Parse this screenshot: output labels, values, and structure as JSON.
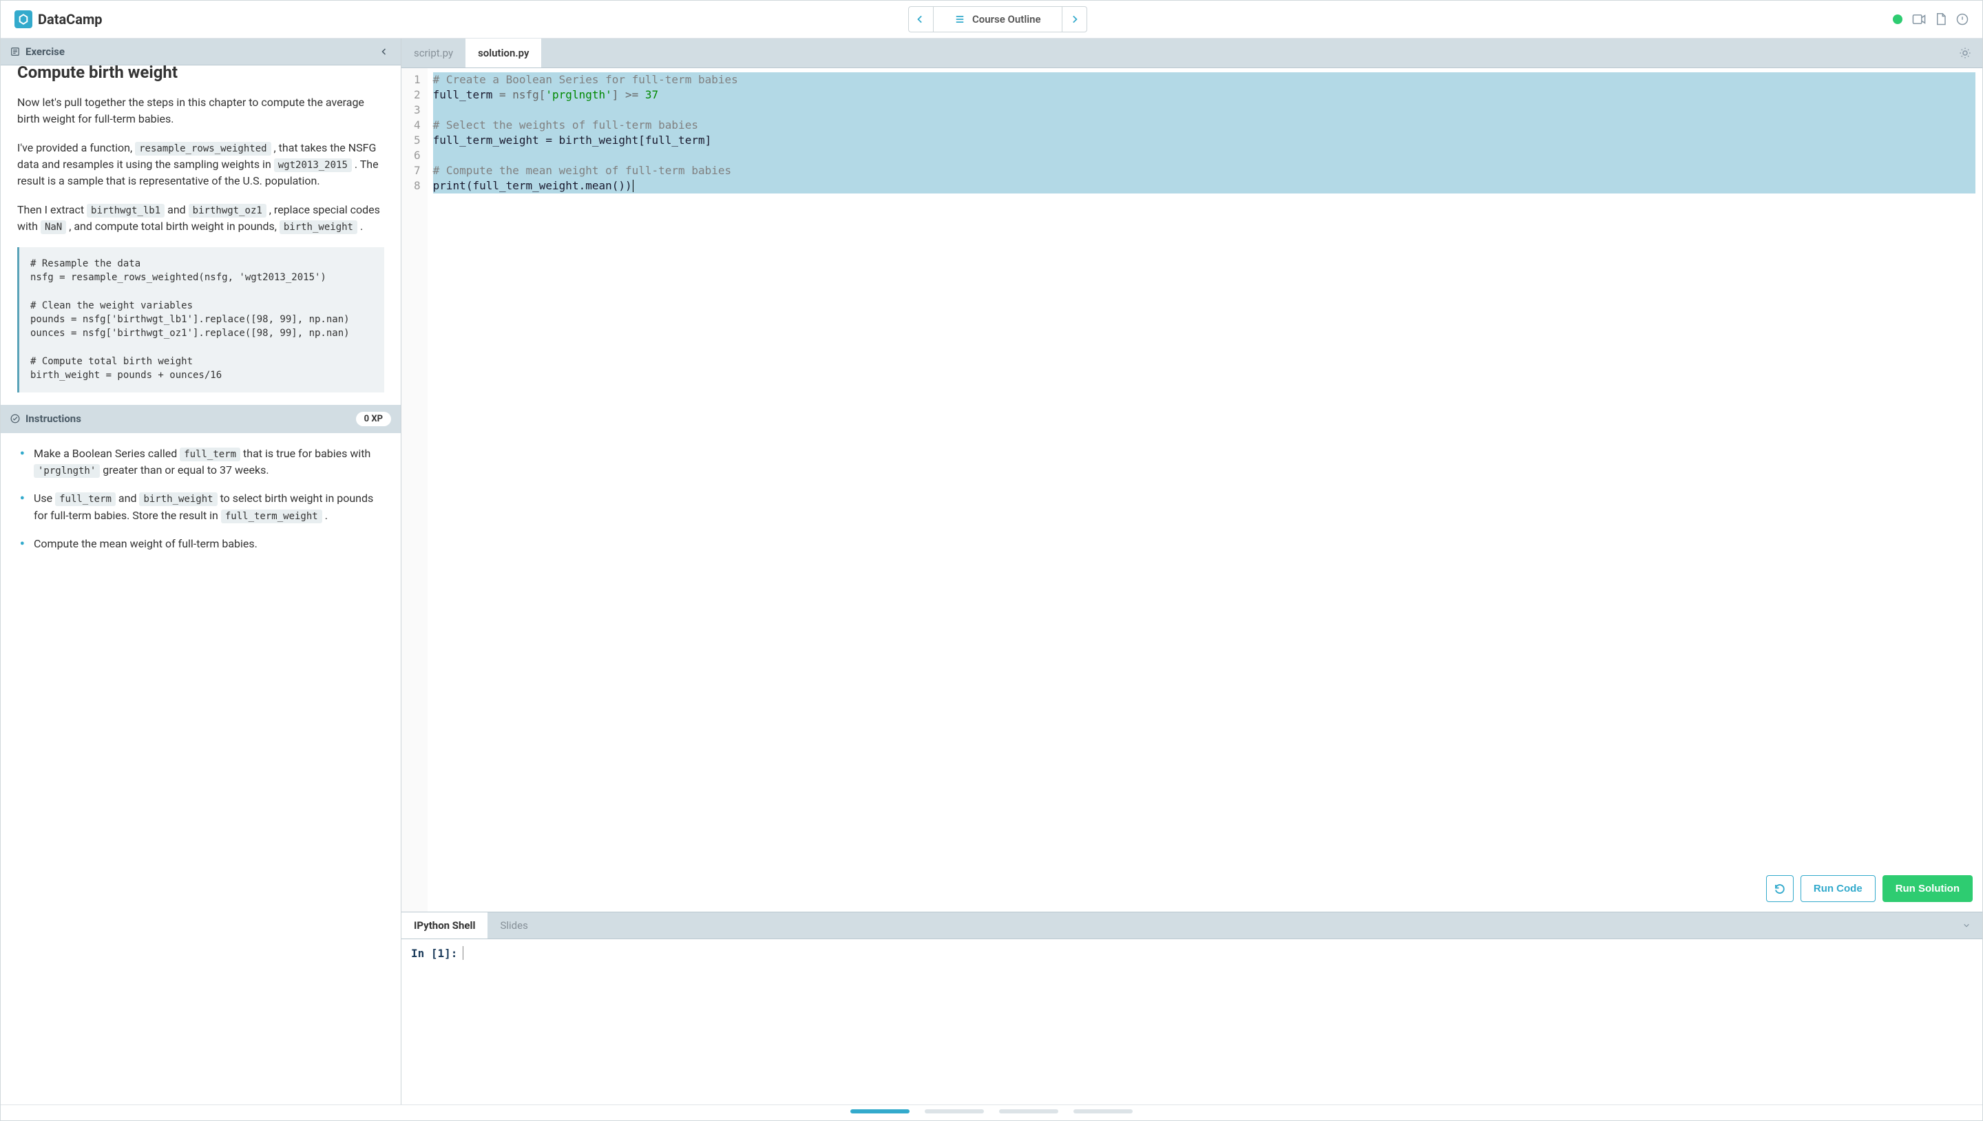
{
  "topbar": {
    "brand": "DataCamp",
    "course_outline": "Course Outline"
  },
  "left": {
    "exercise_label": "Exercise",
    "title": "Compute birth weight",
    "p1": "Now let's pull together the steps in this chapter to compute the average birth weight for full-term babies.",
    "p2_a": "I've provided a function, ",
    "p2_code1": "resample_rows_weighted",
    "p2_b": " , that takes the NSFG data and resamples it using the sampling weights in ",
    "p2_code2": "wgt2013_2015",
    "p2_c": " . The result is a sample that is representative of the U.S. population.",
    "p3_a": "Then I extract ",
    "p3_code1": "birthwgt_lb1",
    "p3_b": " and ",
    "p3_code2": "birthwgt_oz1",
    "p3_c": " , replace special codes with ",
    "p3_code3": "NaN",
    "p3_d": " , and compute total birth weight in pounds, ",
    "p3_code4": "birth_weight",
    "p3_e": " .",
    "codeblock": "# Resample the data\nnsfg = resample_rows_weighted(nsfg, 'wgt2013_2015')\n\n# Clean the weight variables\npounds = nsfg['birthwgt_lb1'].replace([98, 99], np.nan)\nounces = nsfg['birthwgt_oz1'].replace([98, 99], np.nan)\n\n# Compute total birth weight\nbirth_weight = pounds + ounces/16",
    "instructions_label": "Instructions",
    "xp": "0 XP",
    "inst1_a": "Make a Boolean Series called ",
    "inst1_code1": "full_term",
    "inst1_b": " that is true for babies with ",
    "inst1_code2": "'prglngth'",
    "inst1_c": " greater than or equal to 37 weeks.",
    "inst2_a": "Use ",
    "inst2_code1": "full_term",
    "inst2_b": " and ",
    "inst2_code2": "birth_weight",
    "inst2_c": " to select birth weight in pounds for full-term babies. Store the result in ",
    "inst2_code3": "full_term_weight",
    "inst2_d": " .",
    "inst3": "Compute the mean weight of full-term babies."
  },
  "editor": {
    "tabs": [
      "script.py",
      "solution.py"
    ],
    "active_tab": 1,
    "lines": {
      "1_comment": "# Create a Boolean Series for full-term babies",
      "2_ident": "full_term",
      "2_rest1": " = nsfg[",
      "2_str": "'prglngth'",
      "2_rest2": "] >= ",
      "2_num": "37",
      "4_comment": "# Select the weights of full-term babies",
      "5": "full_term_weight = birth_weight[full_term]",
      "7_comment": "# Compute the mean weight of full-term babies",
      "8_print": "print",
      "8_rest": "(full_term_weight.mean())"
    },
    "buttons": {
      "run": "Run Code",
      "submit": "Run Solution"
    }
  },
  "shell": {
    "tabs": [
      "IPython Shell",
      "Slides"
    ],
    "active_tab": 0,
    "prompt": "In [1]:"
  },
  "progress": {
    "segments": 4,
    "active": 0
  }
}
